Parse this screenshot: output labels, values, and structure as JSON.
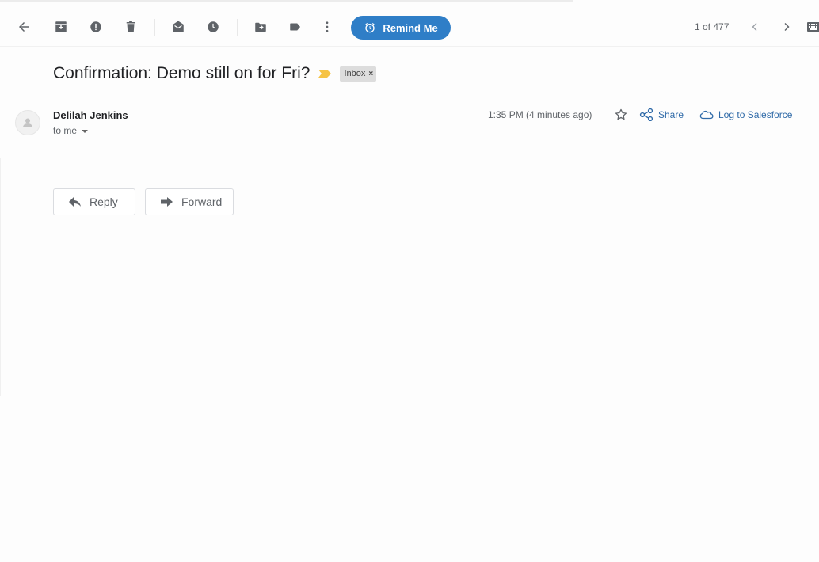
{
  "toolbar": {
    "icons": [
      "back-arrow-icon",
      "archive-icon",
      "report-spam-icon",
      "delete-icon",
      "mark-unread-icon",
      "snooze-icon",
      "move-to-icon",
      "labels-icon",
      "more-icon"
    ],
    "remind_label": "Remind Me",
    "remind_color": "#2f7ec7",
    "pager": "1 of 477"
  },
  "message": {
    "subject": "Confirmation: Demo still on for Fri?",
    "label": "Inbox",
    "label_close": "×",
    "sender": "Delilah Jenkins",
    "recipient": "to me",
    "timestamp": "1:35 PM (4 minutes ago)",
    "share_label": "Share",
    "salesforce_label": "Log to Salesforce",
    "link_color": "#2f6aa8",
    "important_color": "#f6c344"
  },
  "actions": {
    "reply_label": "Reply",
    "forward_label": "Forward"
  }
}
